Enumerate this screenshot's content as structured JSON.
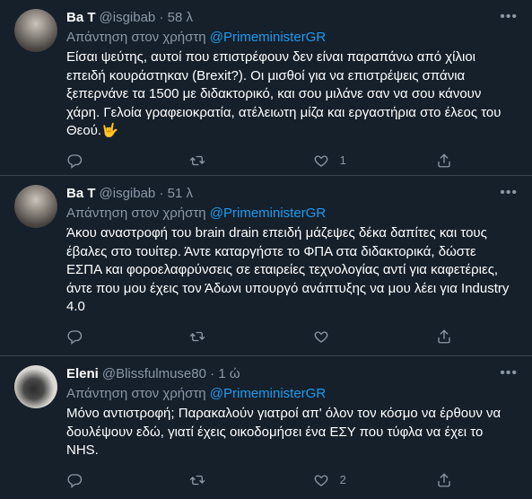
{
  "replying_prefix": "Απάντηση στον χρήστη",
  "tweets": [
    {
      "name": "Ba T",
      "handle": "@isgibab",
      "time": "58 λ",
      "reply_to": "@PrimeministerGR",
      "text": "Είσαι ψεύτης, αυτοί που επιστρέφουν δεν είναι παραπάνω από χίλιοι επειδή κουράστηκαν (Brexit?). Οι μισθοί για να επιστρέψεις σπάνια ξεπερνάνε τα 1500 με διδακτορικό, και σου μιλάνε σαν να σου κάνουν χάρη. Γελοία γραφειοκρατία, ατέλειωτη μίζα  και εργαστήρια στο έλεος του Θεού.",
      "emoji": "🤟",
      "reply_count": "",
      "retweet_count": "",
      "like_count": "1"
    },
    {
      "name": "Ba T",
      "handle": "@isgibab",
      "time": "51 λ",
      "reply_to": "@PrimeministerGR",
      "text": "Άκου αναστροφή του brain drain επειδή μάζεψες δέκα δαπίτες και τους έβαλες στο τουίτερ. Άντε καταργήστε το ΦΠΑ στα διδακτορικά, δώστε ΕΣΠΑ και φοροελαφρύνσεις σε εταιρείες τεχνολογίας αντί για καφετέριες, άντε που μου έχεις τον Άδωνι υπουργό ανάπτυξης να μου λέει για Industry 4.0",
      "reply_count": "",
      "retweet_count": "",
      "like_count": ""
    },
    {
      "name": "Eleni",
      "handle": "@Blissfulmuse80",
      "time": "1 ώ",
      "reply_to": "@PrimeministerGR",
      "text": "Μόνο αντιστροφή; Παρακαλούν γιατροί απ' όλον τον κόσμο να έρθουν να δουλέψουν εδώ, γιατί έχεις οικοδομήσει ένα ΕΣΥ που τύφλα να έχει το NHS.",
      "reply_count": "",
      "retweet_count": "",
      "like_count": "2"
    }
  ],
  "colors": {
    "background": "#15202b",
    "text": "#ffffff",
    "muted": "#8b98a5",
    "accent": "#1d9bf0",
    "divider": "#38444d"
  },
  "icons": [
    "reply-icon",
    "retweet-icon",
    "like-icon",
    "share-icon",
    "more-icon"
  ]
}
